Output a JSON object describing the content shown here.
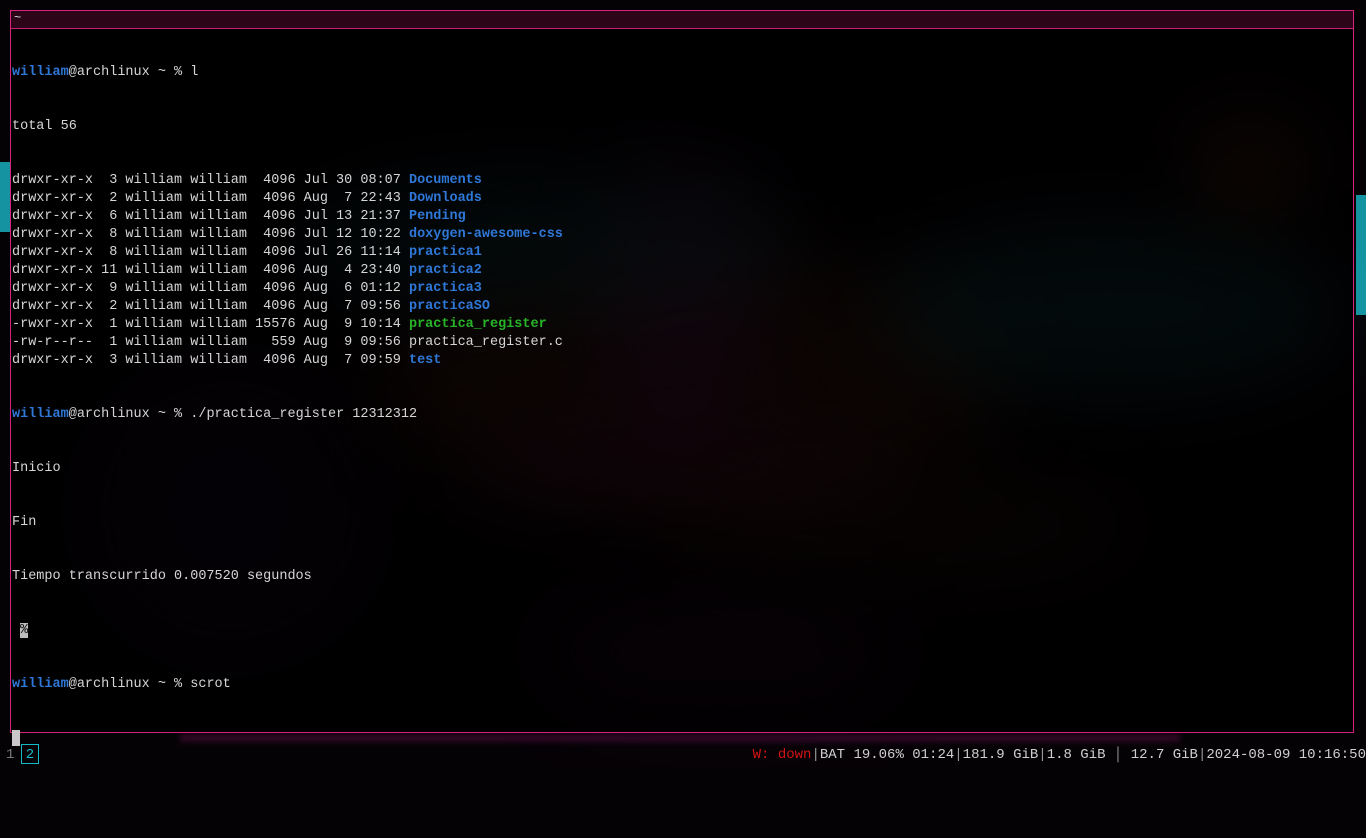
{
  "terminal": {
    "title": "~",
    "prompt": {
      "user": "william",
      "host_suffix": "@archlinux ~ % ",
      "stray_prompt": "%"
    },
    "lines": {
      "cmd_l": "l",
      "total": "total 56",
      "cmd_run": "./practica_register 12312312",
      "out_inicio": "Inicio",
      "out_fin": "Fin",
      "out_tiempo": "Tiempo transcurrido 0.007520 segundos",
      "cmd_scrot": "scrot"
    },
    "listing": [
      {
        "meta": "drwxr-xr-x  3 william william  4096 Jul 30 08:07 ",
        "name": "Documents",
        "kind": "dir"
      },
      {
        "meta": "drwxr-xr-x  2 william william  4096 Aug  7 22:43 ",
        "name": "Downloads",
        "kind": "dir"
      },
      {
        "meta": "drwxr-xr-x  6 william william  4096 Jul 13 21:37 ",
        "name": "Pending",
        "kind": "dir"
      },
      {
        "meta": "drwxr-xr-x  8 william william  4096 Jul 12 10:22 ",
        "name": "doxygen-awesome-css",
        "kind": "dir"
      },
      {
        "meta": "drwxr-xr-x  8 william william  4096 Jul 26 11:14 ",
        "name": "practica1",
        "kind": "dir"
      },
      {
        "meta": "drwxr-xr-x 11 william william  4096 Aug  4 23:40 ",
        "name": "practica2",
        "kind": "dir"
      },
      {
        "meta": "drwxr-xr-x  9 william william  4096 Aug  6 01:12 ",
        "name": "practica3",
        "kind": "dir"
      },
      {
        "meta": "drwxr-xr-x  2 william william  4096 Aug  7 09:56 ",
        "name": "practicaSO",
        "kind": "dir"
      },
      {
        "meta": "-rwxr-xr-x  1 william william 15576 Aug  9 10:14 ",
        "name": "practica_register",
        "kind": "exec"
      },
      {
        "meta": "-rw-r--r--  1 william william   559 Aug  9 09:56 ",
        "name": "practica_register.c",
        "kind": "file"
      },
      {
        "meta": "drwxr-xr-x  3 william william  4096 Aug  7 09:59 ",
        "name": "test",
        "kind": "dir"
      }
    ]
  },
  "statusbar": {
    "workspaces": [
      "1",
      "2"
    ],
    "wifi": "W: down",
    "battery": "BAT 19.06% 01:24",
    "disk": "181.9 GiB",
    "mem": "1.8 GiB",
    "swap": "12.7 GiB",
    "datetime": "2024-08-09 10:16:50"
  },
  "colors": {
    "accent_border": "#d6217f",
    "directory": "#2f78d8",
    "executable": "#28b428",
    "wifi_down": "#d21414",
    "workspace_active": "#15b8c8"
  }
}
